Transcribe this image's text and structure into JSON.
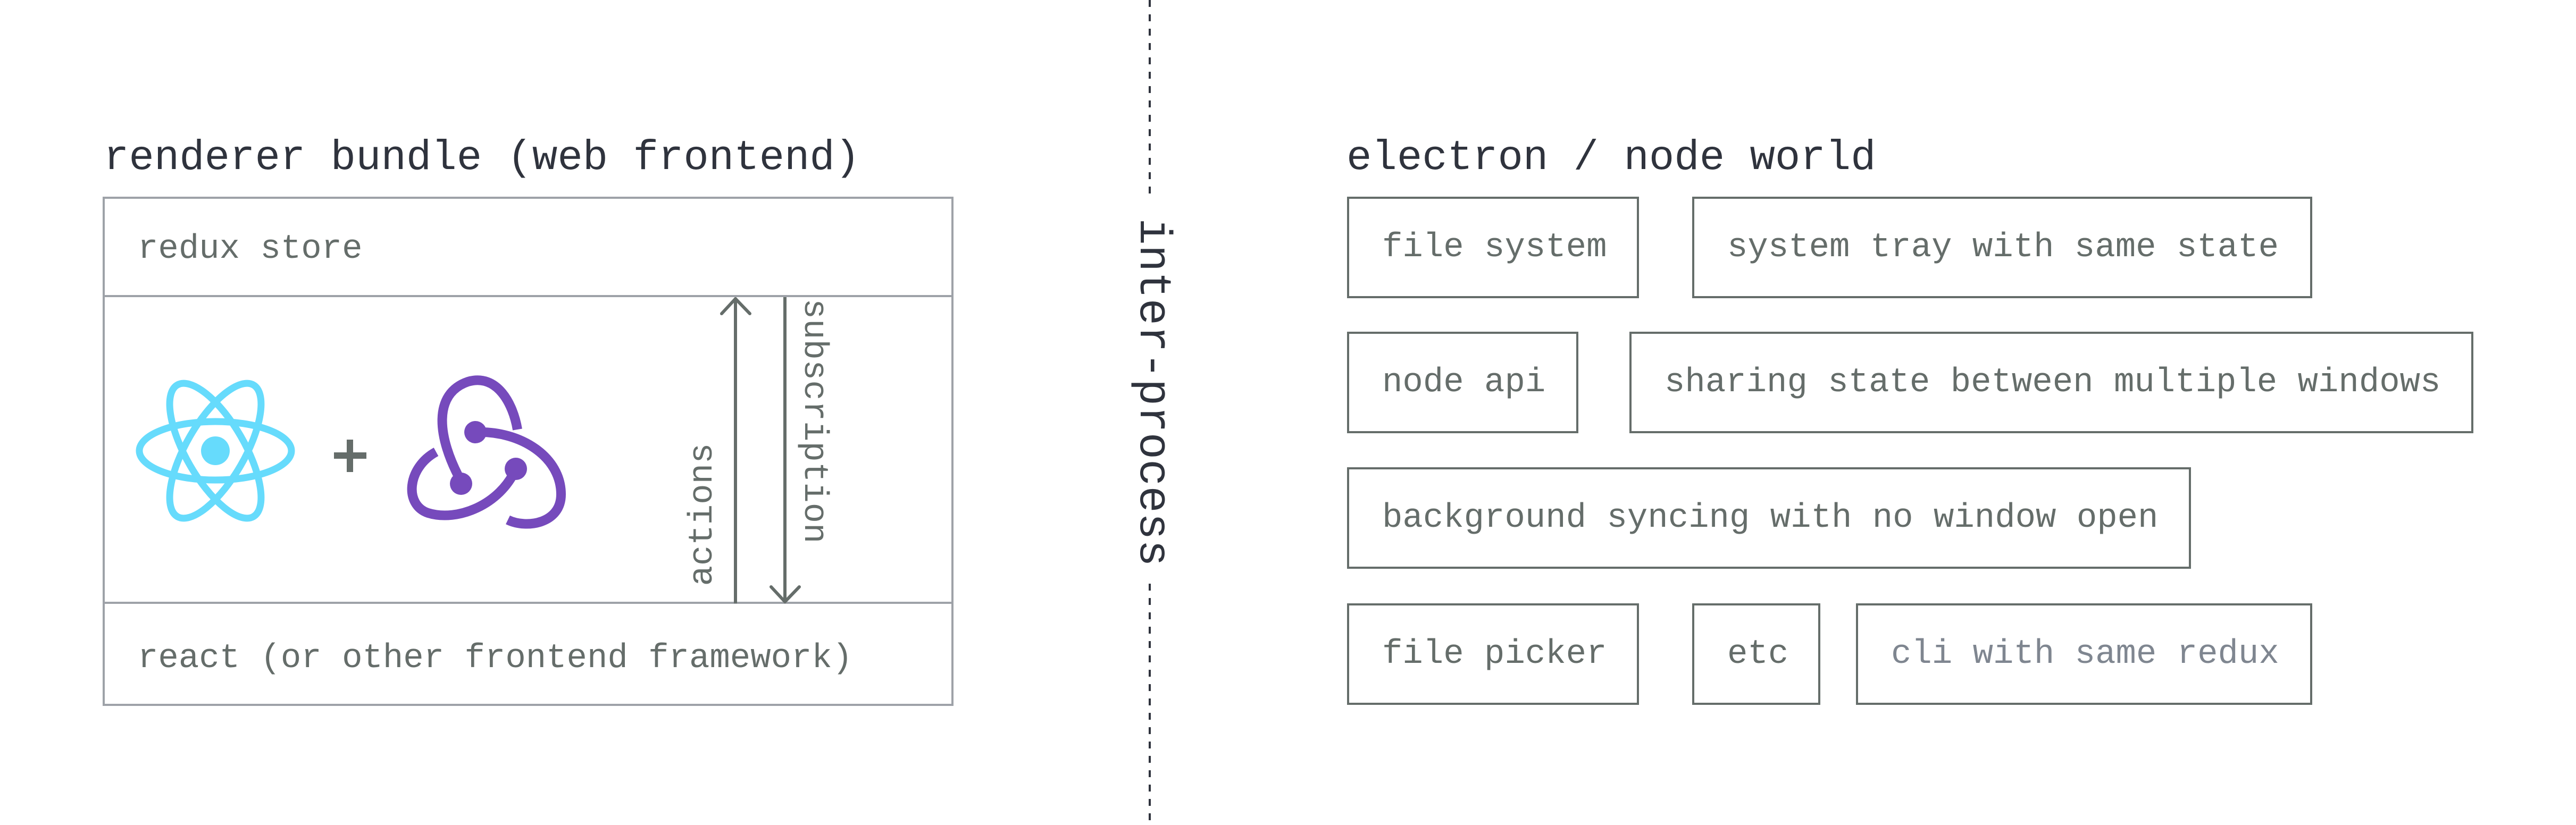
{
  "renderer": {
    "title": "renderer bundle (web frontend)",
    "store_label": "redux store",
    "framework_label": "react (or other frontend framework)",
    "plus": "+",
    "actions_label": "actions",
    "subscription_label": "subscription",
    "logos": {
      "react": {
        "icon": "react-logo-icon",
        "color": "#61dafb"
      },
      "redux": {
        "icon": "redux-logo-icon",
        "color": "#764abc"
      }
    }
  },
  "separator": {
    "label": "inter-process"
  },
  "node_world": {
    "title": "electron / node world",
    "rows": [
      [
        {
          "label": "file system"
        },
        {
          "label": "system tray with same state"
        }
      ],
      [
        {
          "label": "node api"
        },
        {
          "label": "sharing state between multiple windows"
        }
      ],
      [
        {
          "label": "background syncing with no window open"
        }
      ],
      [
        {
          "label": "file picker"
        },
        {
          "label": "etc"
        },
        {
          "label": "cli with same redux",
          "muted": true
        }
      ]
    ]
  },
  "colors": {
    "title_text": "#2f333d",
    "body_text": "#656d6a",
    "muted_text": "#7f8690",
    "left_border": "#9ea2a8",
    "right_border": "#656d6a"
  }
}
